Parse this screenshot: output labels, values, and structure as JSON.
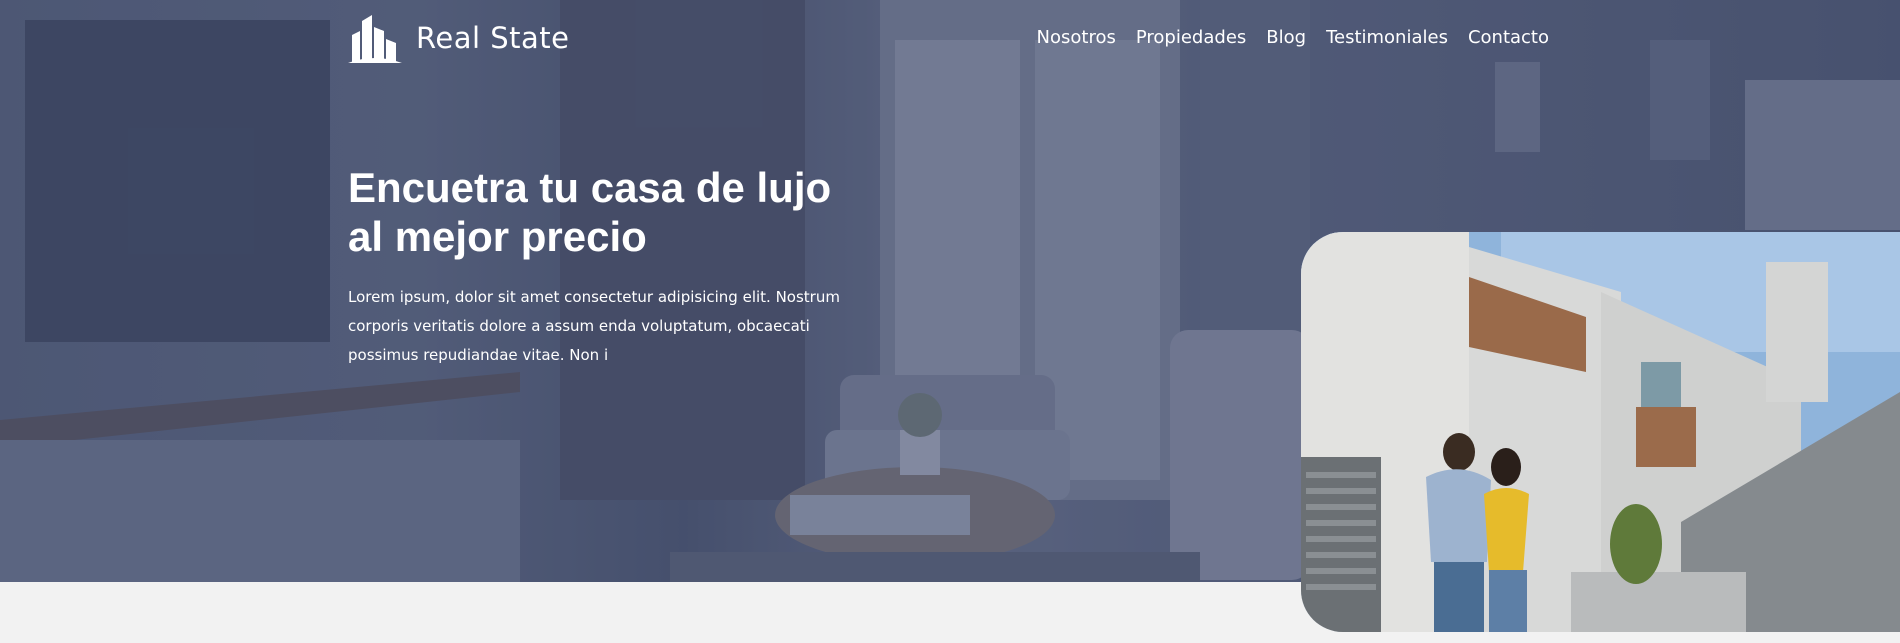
{
  "brand": {
    "name": "Real State",
    "icon": "buildings-icon"
  },
  "nav": {
    "items": [
      "Nosotros",
      "Propiedades",
      "Blog",
      "Testimoniales",
      "Contacto"
    ]
  },
  "hero": {
    "title": "Encuetra tu casa de lujo al mejor precio",
    "description": "Lorem ipsum, dolor sit amet consectetur adipisicing elit. Nostrum corporis veritatis dolore a assum enda voluptatum, obcaecati possimus repudiandae vitae. Non i",
    "background": "living-room-photo",
    "image": "couple-house-photo"
  },
  "colors": {
    "overlay": "#3c4868",
    "text": "#ffffff",
    "page_bg": "#f2f2f2"
  }
}
